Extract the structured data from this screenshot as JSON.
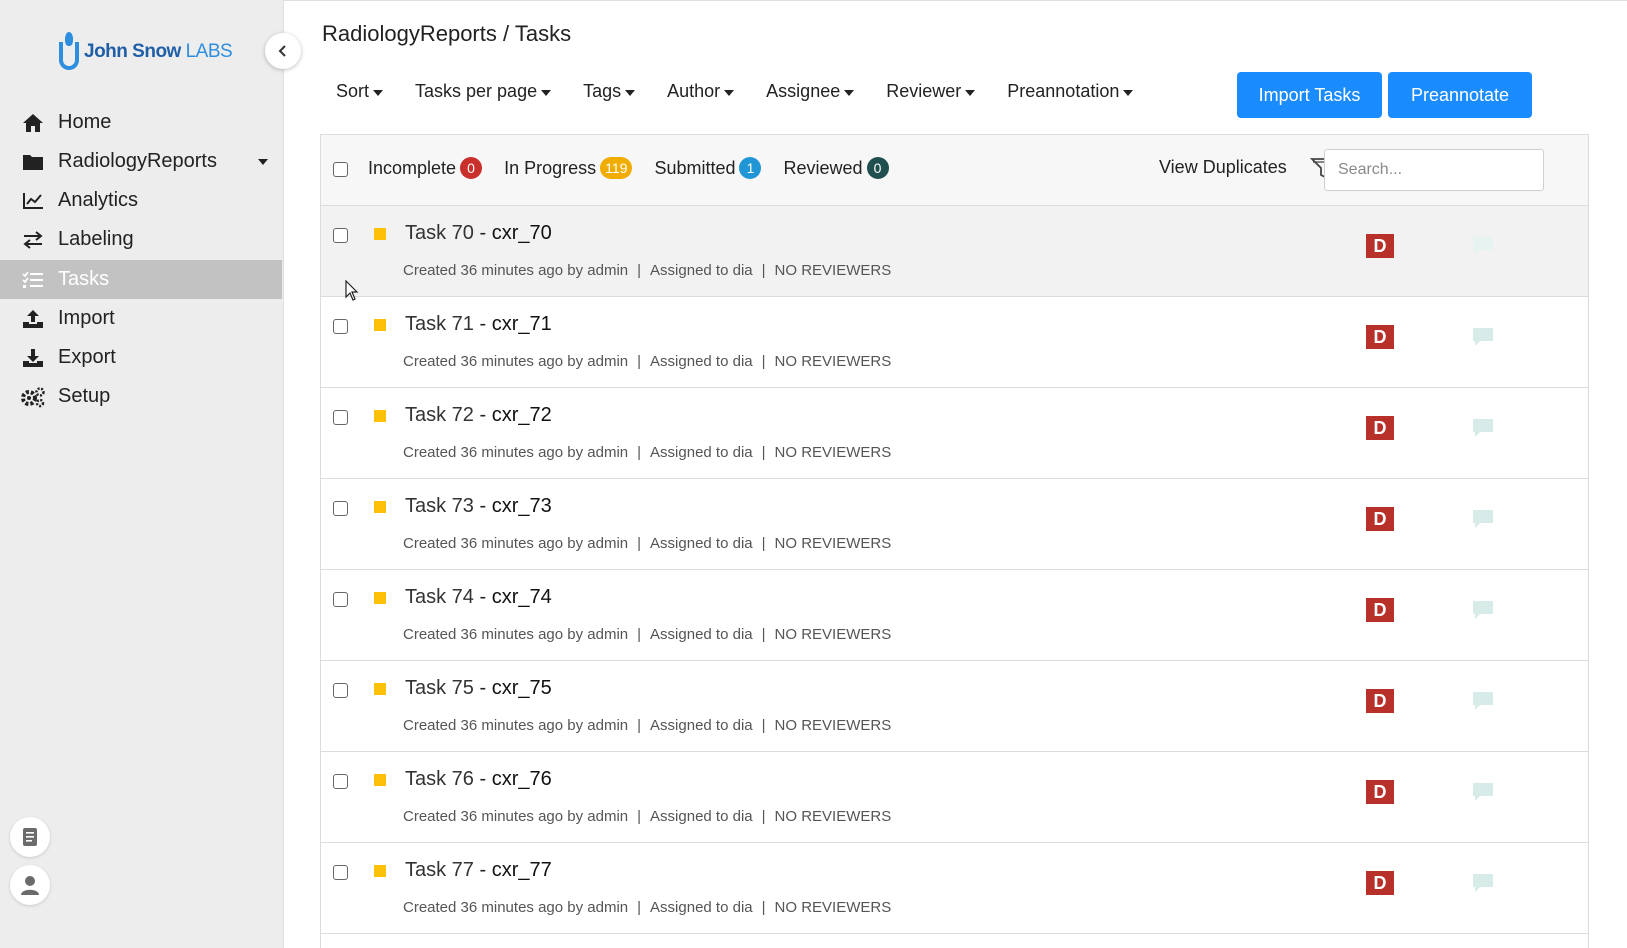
{
  "brand": {
    "name": "John Snow",
    "suffix": "LABS"
  },
  "sidebar": {
    "items": [
      {
        "label": "Home",
        "icon": "home-icon",
        "active": false
      },
      {
        "label": "RadiologyReports",
        "icon": "folder-icon",
        "active": false,
        "expandable": true
      },
      {
        "label": "Analytics",
        "icon": "chart-line-icon",
        "active": false
      },
      {
        "label": "Labeling",
        "icon": "exchange-icon",
        "active": false
      },
      {
        "label": "Tasks",
        "icon": "tasks-list-icon",
        "active": true
      },
      {
        "label": "Import",
        "icon": "upload-icon",
        "active": false
      },
      {
        "label": "Export",
        "icon": "download-icon",
        "active": false
      },
      {
        "label": "Setup",
        "icon": "gears-icon",
        "active": false
      }
    ]
  },
  "header": {
    "project": "RadiologyReports",
    "separator": " / ",
    "page": "Tasks"
  },
  "filters": [
    "Sort",
    "Tasks per page",
    "Tags",
    "Author",
    "Assignee",
    "Reviewer",
    "Preannotation"
  ],
  "actions": {
    "import_label": "Import Tasks",
    "preannotate_label": "Preannotate"
  },
  "status_tabs": [
    {
      "label": "Incomplete",
      "count": "0",
      "color": "#c9302c"
    },
    {
      "label": "In Progress",
      "count": "119",
      "color": "#f0ad00"
    },
    {
      "label": "Submitted",
      "count": "1",
      "color": "#2196d6"
    },
    {
      "label": "Reviewed",
      "count": "0",
      "color": "#1f4f4f"
    }
  ],
  "view_duplicates": "View Duplicates",
  "search": {
    "placeholder": "Search..."
  },
  "tasks": [
    {
      "id": "Task 70",
      "name": "cxr_70",
      "created": "Created 36 minutes ago by admin",
      "assigned": "Assigned to dia",
      "reviewers": "NO REVIEWERS",
      "avatar": "D"
    },
    {
      "id": "Task 71",
      "name": "cxr_71",
      "created": "Created 36 minutes ago by admin",
      "assigned": "Assigned to dia",
      "reviewers": "NO REVIEWERS",
      "avatar": "D"
    },
    {
      "id": "Task 72",
      "name": "cxr_72",
      "created": "Created 36 minutes ago by admin",
      "assigned": "Assigned to dia",
      "reviewers": "NO REVIEWERS",
      "avatar": "D"
    },
    {
      "id": "Task 73",
      "name": "cxr_73",
      "created": "Created 36 minutes ago by admin",
      "assigned": "Assigned to dia",
      "reviewers": "NO REVIEWERS",
      "avatar": "D"
    },
    {
      "id": "Task 74",
      "name": "cxr_74",
      "created": "Created 36 minutes ago by admin",
      "assigned": "Assigned to dia",
      "reviewers": "NO REVIEWERS",
      "avatar": "D"
    },
    {
      "id": "Task 75",
      "name": "cxr_75",
      "created": "Created 36 minutes ago by admin",
      "assigned": "Assigned to dia",
      "reviewers": "NO REVIEWERS",
      "avatar": "D"
    },
    {
      "id": "Task 76",
      "name": "cxr_76",
      "created": "Created 36 minutes ago by admin",
      "assigned": "Assigned to dia",
      "reviewers": "NO REVIEWERS",
      "avatar": "D"
    },
    {
      "id": "Task 77",
      "name": "cxr_77",
      "created": "Created 36 minutes ago by admin",
      "assigned": "Assigned to dia",
      "reviewers": "NO REVIEWERS",
      "avatar": "D"
    }
  ],
  "colors": {
    "accent": "#1a8cff",
    "task_marker": "#ffc107",
    "avatar_bg": "#b8302a",
    "sidebar_bg": "#ededed",
    "sidebar_active": "#c2c2c2"
  }
}
